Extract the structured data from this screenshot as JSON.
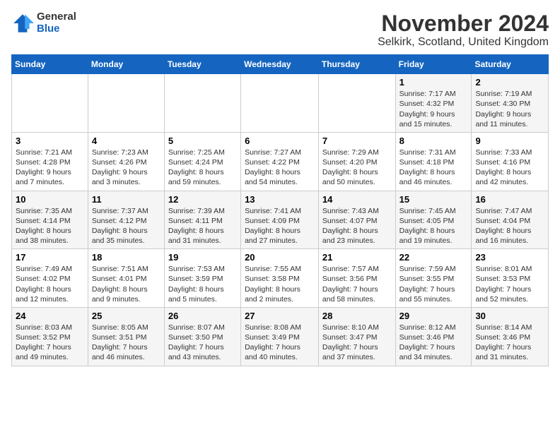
{
  "header": {
    "logo_general": "General",
    "logo_blue": "Blue",
    "title": "November 2024",
    "subtitle": "Selkirk, Scotland, United Kingdom"
  },
  "columns": [
    "Sunday",
    "Monday",
    "Tuesday",
    "Wednesday",
    "Thursday",
    "Friday",
    "Saturday"
  ],
  "weeks": [
    [
      {
        "day": "",
        "info": ""
      },
      {
        "day": "",
        "info": ""
      },
      {
        "day": "",
        "info": ""
      },
      {
        "day": "",
        "info": ""
      },
      {
        "day": "",
        "info": ""
      },
      {
        "day": "1",
        "info": "Sunrise: 7:17 AM\nSunset: 4:32 PM\nDaylight: 9 hours and 15 minutes."
      },
      {
        "day": "2",
        "info": "Sunrise: 7:19 AM\nSunset: 4:30 PM\nDaylight: 9 hours and 11 minutes."
      }
    ],
    [
      {
        "day": "3",
        "info": "Sunrise: 7:21 AM\nSunset: 4:28 PM\nDaylight: 9 hours and 7 minutes."
      },
      {
        "day": "4",
        "info": "Sunrise: 7:23 AM\nSunset: 4:26 PM\nDaylight: 9 hours and 3 minutes."
      },
      {
        "day": "5",
        "info": "Sunrise: 7:25 AM\nSunset: 4:24 PM\nDaylight: 8 hours and 59 minutes."
      },
      {
        "day": "6",
        "info": "Sunrise: 7:27 AM\nSunset: 4:22 PM\nDaylight: 8 hours and 54 minutes."
      },
      {
        "day": "7",
        "info": "Sunrise: 7:29 AM\nSunset: 4:20 PM\nDaylight: 8 hours and 50 minutes."
      },
      {
        "day": "8",
        "info": "Sunrise: 7:31 AM\nSunset: 4:18 PM\nDaylight: 8 hours and 46 minutes."
      },
      {
        "day": "9",
        "info": "Sunrise: 7:33 AM\nSunset: 4:16 PM\nDaylight: 8 hours and 42 minutes."
      }
    ],
    [
      {
        "day": "10",
        "info": "Sunrise: 7:35 AM\nSunset: 4:14 PM\nDaylight: 8 hours and 38 minutes."
      },
      {
        "day": "11",
        "info": "Sunrise: 7:37 AM\nSunset: 4:12 PM\nDaylight: 8 hours and 35 minutes."
      },
      {
        "day": "12",
        "info": "Sunrise: 7:39 AM\nSunset: 4:11 PM\nDaylight: 8 hours and 31 minutes."
      },
      {
        "day": "13",
        "info": "Sunrise: 7:41 AM\nSunset: 4:09 PM\nDaylight: 8 hours and 27 minutes."
      },
      {
        "day": "14",
        "info": "Sunrise: 7:43 AM\nSunset: 4:07 PM\nDaylight: 8 hours and 23 minutes."
      },
      {
        "day": "15",
        "info": "Sunrise: 7:45 AM\nSunset: 4:05 PM\nDaylight: 8 hours and 19 minutes."
      },
      {
        "day": "16",
        "info": "Sunrise: 7:47 AM\nSunset: 4:04 PM\nDaylight: 8 hours and 16 minutes."
      }
    ],
    [
      {
        "day": "17",
        "info": "Sunrise: 7:49 AM\nSunset: 4:02 PM\nDaylight: 8 hours and 12 minutes."
      },
      {
        "day": "18",
        "info": "Sunrise: 7:51 AM\nSunset: 4:01 PM\nDaylight: 8 hours and 9 minutes."
      },
      {
        "day": "19",
        "info": "Sunrise: 7:53 AM\nSunset: 3:59 PM\nDaylight: 8 hours and 5 minutes."
      },
      {
        "day": "20",
        "info": "Sunrise: 7:55 AM\nSunset: 3:58 PM\nDaylight: 8 hours and 2 minutes."
      },
      {
        "day": "21",
        "info": "Sunrise: 7:57 AM\nSunset: 3:56 PM\nDaylight: 7 hours and 58 minutes."
      },
      {
        "day": "22",
        "info": "Sunrise: 7:59 AM\nSunset: 3:55 PM\nDaylight: 7 hours and 55 minutes."
      },
      {
        "day": "23",
        "info": "Sunrise: 8:01 AM\nSunset: 3:53 PM\nDaylight: 7 hours and 52 minutes."
      }
    ],
    [
      {
        "day": "24",
        "info": "Sunrise: 8:03 AM\nSunset: 3:52 PM\nDaylight: 7 hours and 49 minutes."
      },
      {
        "day": "25",
        "info": "Sunrise: 8:05 AM\nSunset: 3:51 PM\nDaylight: 7 hours and 46 minutes."
      },
      {
        "day": "26",
        "info": "Sunrise: 8:07 AM\nSunset: 3:50 PM\nDaylight: 7 hours and 43 minutes."
      },
      {
        "day": "27",
        "info": "Sunrise: 8:08 AM\nSunset: 3:49 PM\nDaylight: 7 hours and 40 minutes."
      },
      {
        "day": "28",
        "info": "Sunrise: 8:10 AM\nSunset: 3:47 PM\nDaylight: 7 hours and 37 minutes."
      },
      {
        "day": "29",
        "info": "Sunrise: 8:12 AM\nSunset: 3:46 PM\nDaylight: 7 hours and 34 minutes."
      },
      {
        "day": "30",
        "info": "Sunrise: 8:14 AM\nSunset: 3:46 PM\nDaylight: 7 hours and 31 minutes."
      }
    ]
  ]
}
